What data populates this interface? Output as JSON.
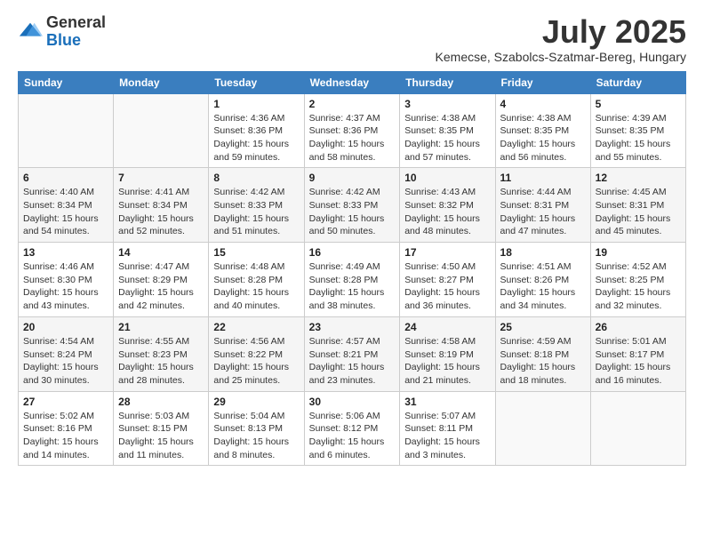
{
  "logo": {
    "general": "General",
    "blue": "Blue"
  },
  "title": "July 2025",
  "location": "Kemecse, Szabolcs-Szatmar-Bereg, Hungary",
  "days_of_week": [
    "Sunday",
    "Monday",
    "Tuesday",
    "Wednesday",
    "Thursday",
    "Friday",
    "Saturday"
  ],
  "weeks": [
    [
      {
        "day": "",
        "info": ""
      },
      {
        "day": "",
        "info": ""
      },
      {
        "day": "1",
        "info": "Sunrise: 4:36 AM\nSunset: 8:36 PM\nDaylight: 15 hours and 59 minutes."
      },
      {
        "day": "2",
        "info": "Sunrise: 4:37 AM\nSunset: 8:36 PM\nDaylight: 15 hours and 58 minutes."
      },
      {
        "day": "3",
        "info": "Sunrise: 4:38 AM\nSunset: 8:35 PM\nDaylight: 15 hours and 57 minutes."
      },
      {
        "day": "4",
        "info": "Sunrise: 4:38 AM\nSunset: 8:35 PM\nDaylight: 15 hours and 56 minutes."
      },
      {
        "day": "5",
        "info": "Sunrise: 4:39 AM\nSunset: 8:35 PM\nDaylight: 15 hours and 55 minutes."
      }
    ],
    [
      {
        "day": "6",
        "info": "Sunrise: 4:40 AM\nSunset: 8:34 PM\nDaylight: 15 hours and 54 minutes."
      },
      {
        "day": "7",
        "info": "Sunrise: 4:41 AM\nSunset: 8:34 PM\nDaylight: 15 hours and 52 minutes."
      },
      {
        "day": "8",
        "info": "Sunrise: 4:42 AM\nSunset: 8:33 PM\nDaylight: 15 hours and 51 minutes."
      },
      {
        "day": "9",
        "info": "Sunrise: 4:42 AM\nSunset: 8:33 PM\nDaylight: 15 hours and 50 minutes."
      },
      {
        "day": "10",
        "info": "Sunrise: 4:43 AM\nSunset: 8:32 PM\nDaylight: 15 hours and 48 minutes."
      },
      {
        "day": "11",
        "info": "Sunrise: 4:44 AM\nSunset: 8:31 PM\nDaylight: 15 hours and 47 minutes."
      },
      {
        "day": "12",
        "info": "Sunrise: 4:45 AM\nSunset: 8:31 PM\nDaylight: 15 hours and 45 minutes."
      }
    ],
    [
      {
        "day": "13",
        "info": "Sunrise: 4:46 AM\nSunset: 8:30 PM\nDaylight: 15 hours and 43 minutes."
      },
      {
        "day": "14",
        "info": "Sunrise: 4:47 AM\nSunset: 8:29 PM\nDaylight: 15 hours and 42 minutes."
      },
      {
        "day": "15",
        "info": "Sunrise: 4:48 AM\nSunset: 8:28 PM\nDaylight: 15 hours and 40 minutes."
      },
      {
        "day": "16",
        "info": "Sunrise: 4:49 AM\nSunset: 8:28 PM\nDaylight: 15 hours and 38 minutes."
      },
      {
        "day": "17",
        "info": "Sunrise: 4:50 AM\nSunset: 8:27 PM\nDaylight: 15 hours and 36 minutes."
      },
      {
        "day": "18",
        "info": "Sunrise: 4:51 AM\nSunset: 8:26 PM\nDaylight: 15 hours and 34 minutes."
      },
      {
        "day": "19",
        "info": "Sunrise: 4:52 AM\nSunset: 8:25 PM\nDaylight: 15 hours and 32 minutes."
      }
    ],
    [
      {
        "day": "20",
        "info": "Sunrise: 4:54 AM\nSunset: 8:24 PM\nDaylight: 15 hours and 30 minutes."
      },
      {
        "day": "21",
        "info": "Sunrise: 4:55 AM\nSunset: 8:23 PM\nDaylight: 15 hours and 28 minutes."
      },
      {
        "day": "22",
        "info": "Sunrise: 4:56 AM\nSunset: 8:22 PM\nDaylight: 15 hours and 25 minutes."
      },
      {
        "day": "23",
        "info": "Sunrise: 4:57 AM\nSunset: 8:21 PM\nDaylight: 15 hours and 23 minutes."
      },
      {
        "day": "24",
        "info": "Sunrise: 4:58 AM\nSunset: 8:19 PM\nDaylight: 15 hours and 21 minutes."
      },
      {
        "day": "25",
        "info": "Sunrise: 4:59 AM\nSunset: 8:18 PM\nDaylight: 15 hours and 18 minutes."
      },
      {
        "day": "26",
        "info": "Sunrise: 5:01 AM\nSunset: 8:17 PM\nDaylight: 15 hours and 16 minutes."
      }
    ],
    [
      {
        "day": "27",
        "info": "Sunrise: 5:02 AM\nSunset: 8:16 PM\nDaylight: 15 hours and 14 minutes."
      },
      {
        "day": "28",
        "info": "Sunrise: 5:03 AM\nSunset: 8:15 PM\nDaylight: 15 hours and 11 minutes."
      },
      {
        "day": "29",
        "info": "Sunrise: 5:04 AM\nSunset: 8:13 PM\nDaylight: 15 hours and 8 minutes."
      },
      {
        "day": "30",
        "info": "Sunrise: 5:06 AM\nSunset: 8:12 PM\nDaylight: 15 hours and 6 minutes."
      },
      {
        "day": "31",
        "info": "Sunrise: 5:07 AM\nSunset: 8:11 PM\nDaylight: 15 hours and 3 minutes."
      },
      {
        "day": "",
        "info": ""
      },
      {
        "day": "",
        "info": ""
      }
    ]
  ]
}
